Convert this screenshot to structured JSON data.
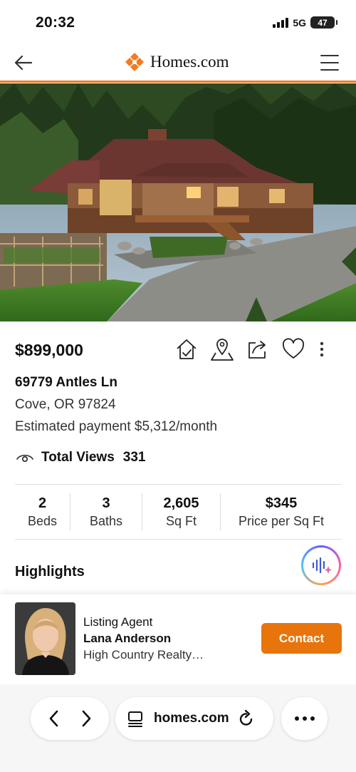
{
  "status": {
    "time": "20:32",
    "network": "5G",
    "battery": "47"
  },
  "header": {
    "logo_text": "Homes.com"
  },
  "listing": {
    "price": "$899,000",
    "address_line1": "69779 Antles Ln",
    "address_line2": "Cove, OR 97824",
    "estimated_payment": "Estimated payment $5,312/month",
    "views_label": "Total Views",
    "views_count": "331",
    "stats": [
      {
        "value": "2",
        "label": "Beds"
      },
      {
        "value": "3",
        "label": "Baths"
      },
      {
        "value": "2,605",
        "label": "Sq Ft"
      },
      {
        "value": "$345",
        "label": "Price per Sq Ft"
      }
    ],
    "section_title": "Highlights"
  },
  "agent": {
    "role": "Listing Agent",
    "name": "Lana Anderson",
    "company": "High Country Realty…",
    "contact_label": "Contact"
  },
  "browser": {
    "url": "homes.com"
  },
  "colors": {
    "brand_orange": "#f47b20",
    "contact_button": "#e8740c"
  },
  "icons": [
    "back-arrow-icon",
    "homes-logo-icon",
    "hamburger-menu-icon",
    "home-check-icon",
    "map-pin-icon",
    "share-icon",
    "heart-icon",
    "vertical-dots-icon",
    "eye-icon",
    "ai-voice-icon",
    "chevron-left-icon",
    "chevron-right-icon",
    "reader-icon",
    "reload-icon",
    "more-dots-icon"
  ]
}
